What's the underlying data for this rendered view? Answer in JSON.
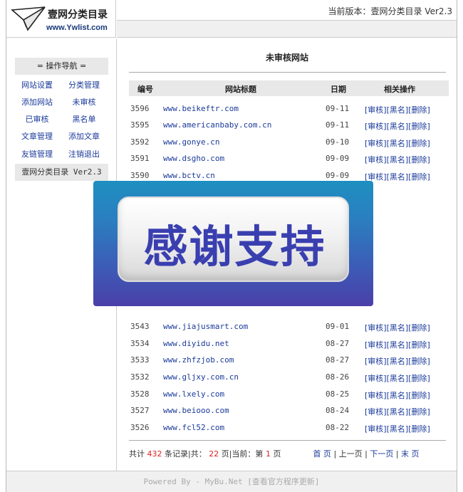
{
  "header": {
    "logo_title": "壹网分类目录",
    "logo_url": "www.Ywlist.com",
    "version_text": "当前版本：壹网分类目录 Ver2.3"
  },
  "sidebar": {
    "title": "= 操作导航 =",
    "items": [
      {
        "label": "网站设置"
      },
      {
        "label": "分类管理"
      },
      {
        "label": "添加网站"
      },
      {
        "label": "未审核"
      },
      {
        "label": "已审核"
      },
      {
        "label": "黑名单"
      },
      {
        "label": "文章管理"
      },
      {
        "label": "添加文章"
      },
      {
        "label": "友链管理"
      },
      {
        "label": "注销退出"
      }
    ],
    "version": "壹网分类目录 Ver2.3"
  },
  "main": {
    "title": "未审核网站",
    "columns": [
      "编号",
      "网站标题",
      "日期",
      "相关操作"
    ],
    "ops": {
      "approve": "[审核]",
      "blacklist": "[黑名",
      "delete": "[删除]"
    },
    "rows": [
      {
        "id": "3596",
        "url": "www.beikeftr.com",
        "date": "09-11",
        "show": true
      },
      {
        "id": "3595",
        "url": "www.americanbaby.com.cn",
        "date": "09-11",
        "show": true
      },
      {
        "id": "3592",
        "url": "www.gonye.cn",
        "date": "09-10",
        "show": true
      },
      {
        "id": "3591",
        "url": "www.dsgho.com",
        "date": "09-09",
        "show": true
      },
      {
        "id": "3590",
        "url": "www.bctv.cn",
        "date": "09-09",
        "show": true
      },
      {
        "id": "3543",
        "url": "www.jiajusmart.com",
        "date": "09-01",
        "show": true
      },
      {
        "id": "3534",
        "url": "www.diyidu.net",
        "date": "08-27",
        "show": true
      },
      {
        "id": "3533",
        "url": "www.zhfzjob.com",
        "date": "08-27",
        "show": true
      },
      {
        "id": "3532",
        "url": "www.gljxy.com.cn",
        "date": "08-26",
        "show": true
      },
      {
        "id": "3528",
        "url": "www.lxely.com",
        "date": "08-25",
        "show": true
      },
      {
        "id": "3527",
        "url": "www.beiooo.com",
        "date": "08-24",
        "show": true
      },
      {
        "id": "3526",
        "url": "www.fcl52.com",
        "date": "08-22",
        "show": true
      }
    ],
    "pager": {
      "total_prefix": "共计",
      "total": "432",
      "total_suffix": "条记录|共：",
      "pages": "22",
      "pages_suffix": "页|当前：第",
      "current": "1",
      "current_suffix": "页",
      "first": "首 页",
      "prev": "上一页",
      "next": "下一页",
      "last": "末 页"
    }
  },
  "footer": {
    "text": "Powered By - MyBu.Net [查看官方程序更新]"
  },
  "banner": {
    "text": "感谢支持"
  }
}
